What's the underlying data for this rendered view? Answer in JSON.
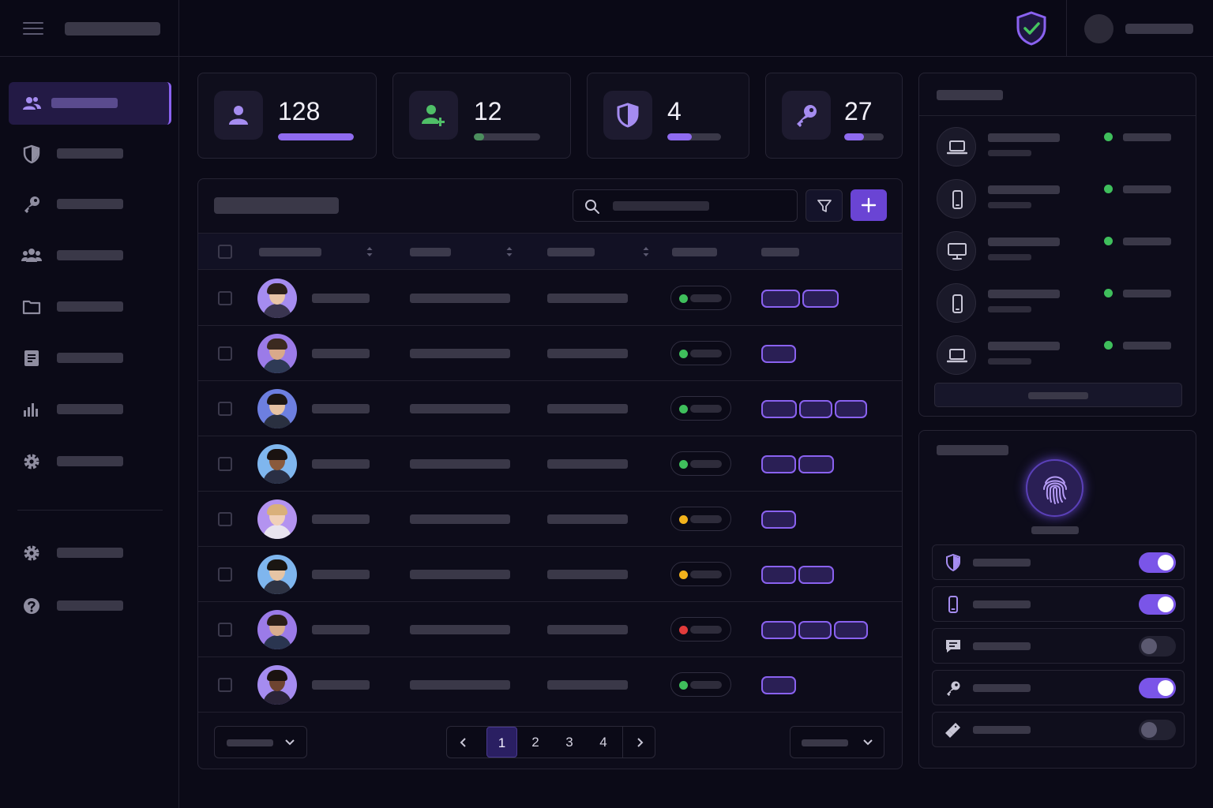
{
  "stats": [
    {
      "value": "128",
      "icon": "user-icon",
      "bar_fill": 1.0,
      "bar_color": "#8f6bf0"
    },
    {
      "value": "12",
      "icon": "add-user-icon",
      "bar_fill": 0.15,
      "bar_color": "#4c8f5e"
    },
    {
      "value": "4",
      "icon": "shield-icon",
      "bar_fill": 0.45,
      "bar_color": "#8f6bf0"
    },
    {
      "value": "27",
      "icon": "key-icon",
      "bar_fill": 0.5,
      "bar_color": "#8f6bf0"
    }
  ],
  "sidebar": {
    "items": [
      {
        "icon": "users-icon",
        "active": true
      },
      {
        "icon": "shield-icon",
        "active": false
      },
      {
        "icon": "key-icon",
        "active": false
      },
      {
        "icon": "group-icon",
        "active": false
      },
      {
        "icon": "folder-icon",
        "active": false
      },
      {
        "icon": "document-icon",
        "active": false
      },
      {
        "icon": "bar-chart-icon",
        "active": false
      },
      {
        "icon": "gear-icon",
        "active": false
      }
    ],
    "bottom": [
      {
        "icon": "gear-icon"
      },
      {
        "icon": "help-icon"
      }
    ]
  },
  "table": {
    "rows": [
      {
        "status": "active",
        "status_color": "#3fbf5c",
        "tags": 2
      },
      {
        "status": "active",
        "status_color": "#3fbf5c",
        "tags": 1
      },
      {
        "status": "active",
        "status_color": "#3fbf5c",
        "tags": 3
      },
      {
        "status": "active",
        "status_color": "#3fbf5c",
        "tags": 2
      },
      {
        "status": "pending",
        "status_color": "#f2b21c",
        "tags": 1
      },
      {
        "status": "pending",
        "status_color": "#f2b21c",
        "tags": 2
      },
      {
        "status": "blocked",
        "status_color": "#e23b3b",
        "tags": 3
      },
      {
        "status": "active",
        "status_color": "#3fbf5c",
        "tags": 1
      }
    ],
    "pagination": {
      "pages": [
        "1",
        "2",
        "3",
        "4"
      ],
      "current": "1"
    }
  },
  "devices": [
    {
      "icon": "laptop-icon",
      "status_color": "#3fbf5c"
    },
    {
      "icon": "phone-icon",
      "status_color": "#3fbf5c"
    },
    {
      "icon": "desktop-icon",
      "status_color": "#3fbf5c"
    },
    {
      "icon": "phone-icon",
      "status_color": "#3fbf5c"
    },
    {
      "icon": "laptop-icon",
      "status_color": "#3fbf5c"
    }
  ],
  "security": {
    "options": [
      {
        "icon": "shield-icon",
        "enabled": true
      },
      {
        "icon": "phone-icon",
        "enabled": true
      },
      {
        "icon": "message-icon",
        "enabled": false
      },
      {
        "icon": "key-icon",
        "enabled": true
      },
      {
        "icon": "usb-key-icon",
        "enabled": false
      }
    ]
  },
  "colors": {
    "accent": "#8a62f0",
    "background": "#0b0a17",
    "success": "#3fbf5c",
    "warning": "#f2b21c",
    "danger": "#e23b3b"
  }
}
